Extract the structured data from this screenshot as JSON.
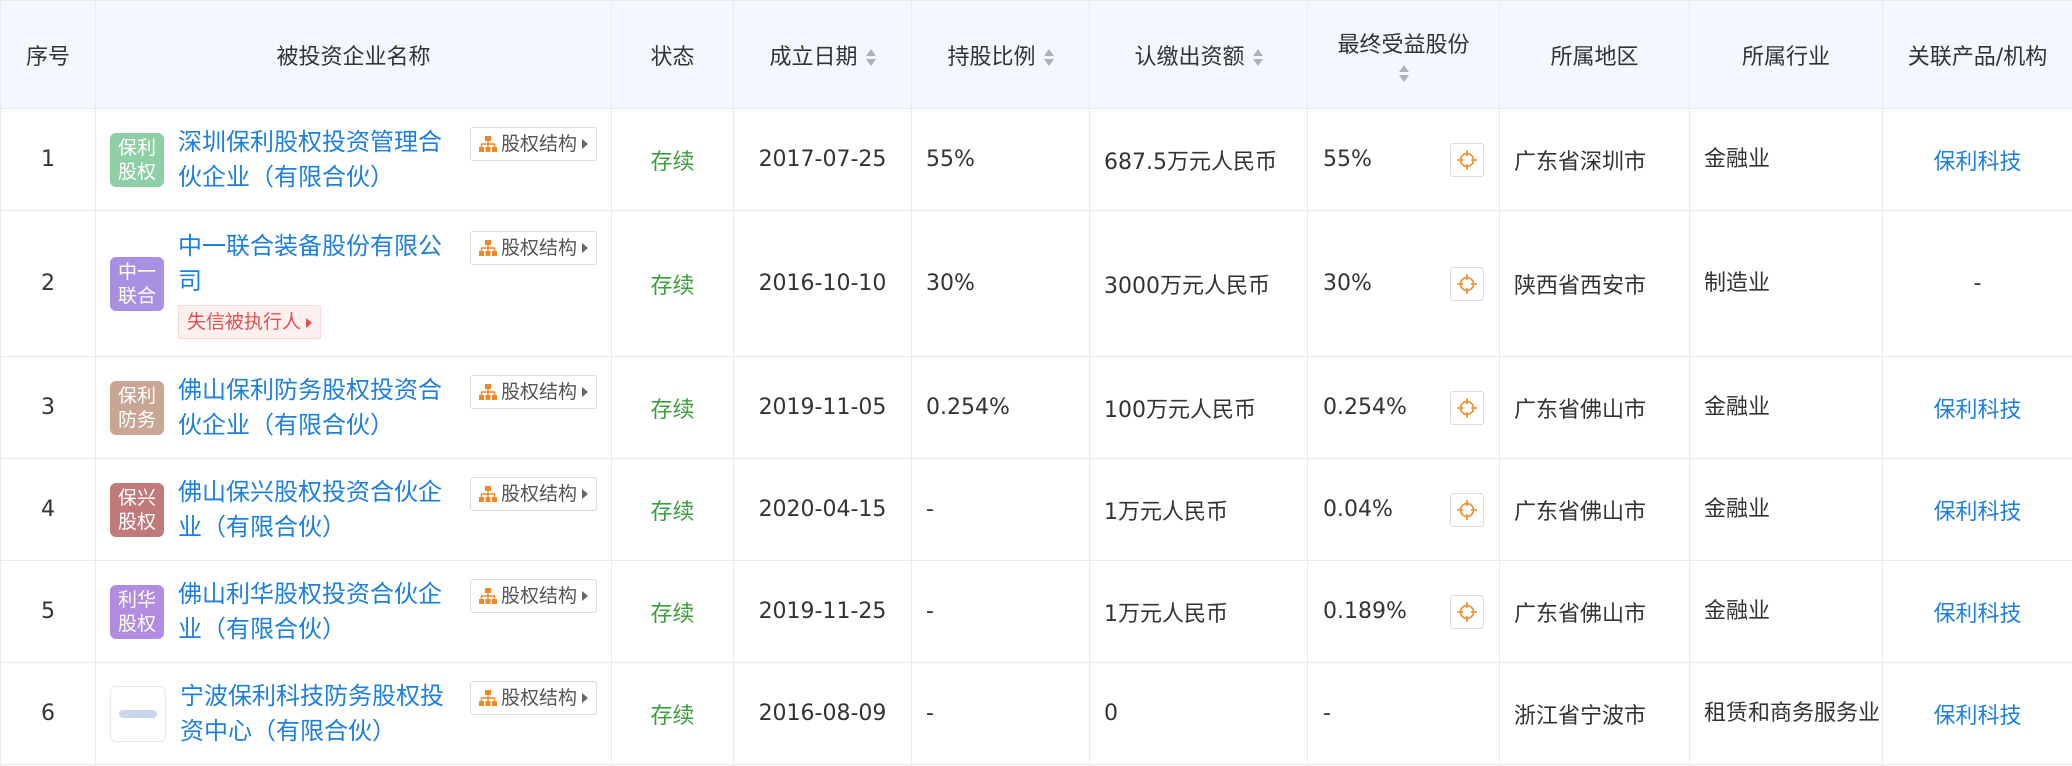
{
  "headers": {
    "idx": "序号",
    "company": "被投资企业名称",
    "status": "状态",
    "date": "成立日期",
    "ratio": "持股比例",
    "capital": "认缴出资额",
    "beneficial": "最终受益股份",
    "region": "所属地区",
    "industry": "所属行业",
    "product": "关联产品/机构"
  },
  "equity_btn_label": "股权结构",
  "rows": [
    {
      "idx": "1",
      "logo": "保利股权",
      "logo_color": "#8fcfa5",
      "name": "深圳保利股权投资管理合伙企业（有限合伙）",
      "status": "存续",
      "date": "2017-07-25",
      "ratio": "55%",
      "capital": "687.5万元人民币",
      "beneficial": "55%",
      "region": "广东省深圳市",
      "industry": "金融业",
      "product": "保利科技"
    },
    {
      "idx": "2",
      "logo": "中一联合",
      "logo_color": "#a98fe0",
      "name": "中一联合装备股份有限公司",
      "tag": "失信被执行人",
      "status": "存续",
      "date": "2016-10-10",
      "ratio": "30%",
      "capital": "3000万元人民币",
      "beneficial": "30%",
      "region": "陕西省西安市",
      "industry": "制造业",
      "product": "-"
    },
    {
      "idx": "3",
      "logo": "保利防务",
      "logo_color": "#c9a693",
      "name": "佛山保利防务股权投资合伙企业（有限合伙）",
      "status": "存续",
      "date": "2019-11-05",
      "ratio": "0.254%",
      "capital": "100万元人民币",
      "beneficial": "0.254%",
      "region": "广东省佛山市",
      "industry": "金融业",
      "product": "保利科技"
    },
    {
      "idx": "4",
      "logo": "保兴股权",
      "logo_color": "#c07a7a",
      "name": "佛山保兴股权投资合伙企业（有限合伙）",
      "status": "存续",
      "date": "2020-04-15",
      "ratio": "-",
      "capital": "1万元人民币",
      "beneficial": "0.04%",
      "region": "广东省佛山市",
      "industry": "金融业",
      "product": "保利科技"
    },
    {
      "idx": "5",
      "logo": "利华股权",
      "logo_color": "#b18ce0",
      "name": "佛山利华股权投资合伙企业（有限合伙）",
      "status": "存续",
      "date": "2019-11-25",
      "ratio": "-",
      "capital": "1万元人民币",
      "beneficial": "0.189%",
      "region": "广东省佛山市",
      "industry": "金融业",
      "product": "保利科技"
    },
    {
      "idx": "6",
      "logo": "",
      "logo_color": "",
      "name": "宁波保利科技防务股权投资中心（有限合伙）",
      "status": "存续",
      "date": "2016-08-09",
      "ratio": "-",
      "capital": "0",
      "beneficial": "-",
      "region": "浙江省宁波市",
      "industry": "租赁和商务服务业",
      "product": "保利科技"
    }
  ],
  "colors": {
    "link": "#1d7fe0",
    "status": "#3a9e3e",
    "header_bg": "#f2f8fd",
    "warn": "#e45050",
    "target": "#f08a24"
  }
}
